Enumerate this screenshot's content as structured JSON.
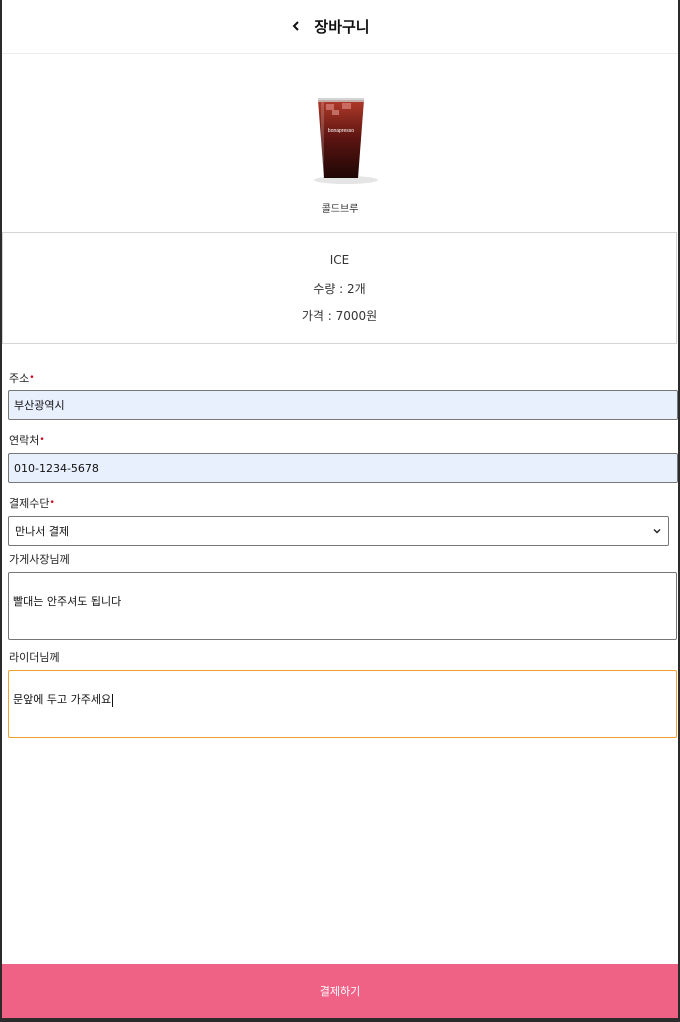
{
  "header": {
    "back_icon": "chevron-left-icon",
    "title": "장바구니"
  },
  "product": {
    "image": "iced-coldbrew-cup",
    "name": "콜드브루",
    "cup_brand": "bonapresso"
  },
  "details": {
    "temperature": "ICE",
    "quantity": "수량 : 2개",
    "price": "가격 : 7000원"
  },
  "form": {
    "required_mark": "•",
    "address": {
      "label": "주소",
      "value": "부산광역시"
    },
    "phone": {
      "label": "연락처",
      "value": "010-1234-5678"
    },
    "payment": {
      "label": "결제수단",
      "selected": "만나서 결제"
    },
    "store_note": {
      "label": "가게사장님께",
      "value": "빨대는 안주셔도 됩니다"
    },
    "rider_note": {
      "label": "라이더님께",
      "value": "문앞에 두고 가주세요"
    }
  },
  "pay_button": {
    "label": "결제하기",
    "color": "#ef6286"
  }
}
